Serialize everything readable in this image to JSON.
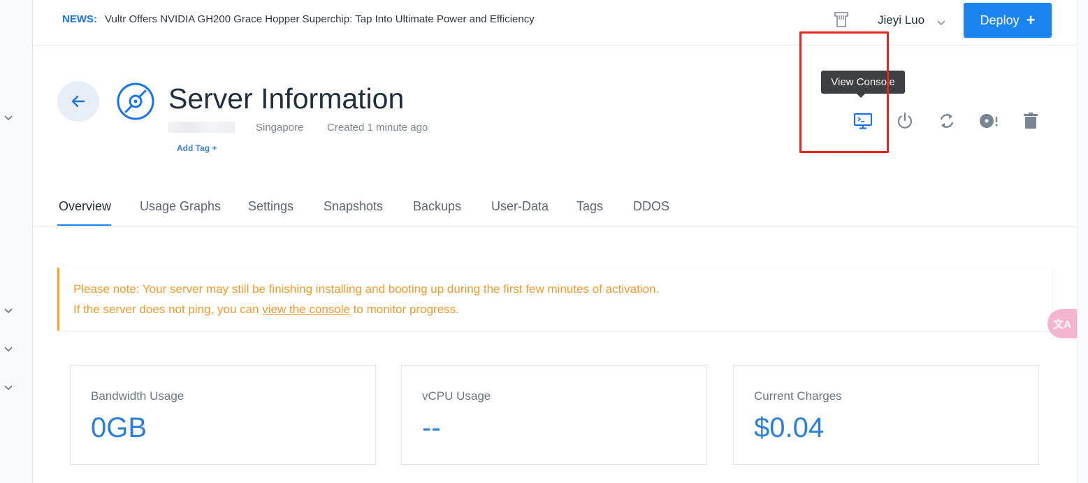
{
  "news": {
    "label": "NEWS:",
    "text": "Vultr Offers NVIDIA GH200 Grace Hopper Superchip: Tap Into Ultimate Power and Efficiency"
  },
  "user": {
    "name": "Jieyi Luo"
  },
  "deploy": {
    "label": "Deploy",
    "plus": "+"
  },
  "header": {
    "title": "Server Information",
    "location": "Singapore",
    "created": "Created 1 minute ago",
    "add_tag": "Add Tag +"
  },
  "actions": {
    "tooltip": "View Console",
    "icons": [
      "console-icon",
      "power-icon",
      "restart-icon",
      "reinstall-icon",
      "delete-icon"
    ]
  },
  "tabs": [
    "Overview",
    "Usage Graphs",
    "Settings",
    "Snapshots",
    "Backups",
    "User-Data",
    "Tags",
    "DDOS"
  ],
  "notice": {
    "line1": "Please note: Your server may still be finishing installing and booting up during the first few minutes of activation.",
    "line2_before": "If the server does not ping, you can ",
    "line2_link": "view the console",
    "line2_after": " to monitor progress."
  },
  "stats": [
    {
      "label": "Bandwidth Usage",
      "value": "0GB"
    },
    {
      "label": "vCPU Usage",
      "value": "--"
    },
    {
      "label": "Current Charges",
      "value": "$0.04"
    }
  ],
  "translate": {
    "label": "文A"
  },
  "colors": {
    "accent": "#1a85f0",
    "notice": "#f09a2b",
    "highlight": "#e8241c"
  }
}
